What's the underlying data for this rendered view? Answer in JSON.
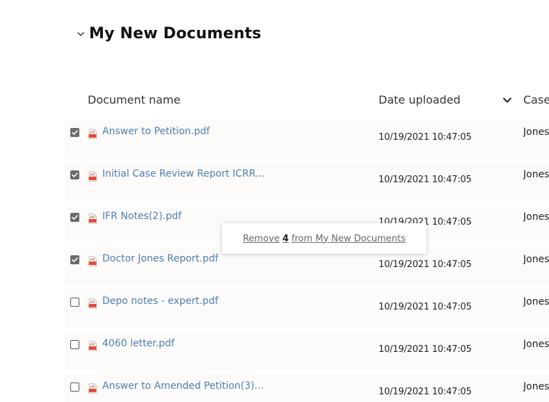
{
  "section": {
    "title": "My New Documents",
    "collapse_icon": "chevron-down-icon"
  },
  "table": {
    "columns": [
      "Document name",
      "Date uploaded",
      "Case"
    ],
    "sort_icon": "chevron-down-icon",
    "rows": [
      {
        "name": "Answer to Petition.pdf",
        "date": "10/19/2021 10:47:05",
        "case": "Jones",
        "checked": true
      },
      {
        "name": "Initial Case Review Report ICRR...",
        "date": "10/19/2021 10:47:05",
        "case": "Jones",
        "checked": true
      },
      {
        "name": "IFR Notes(2).pdf",
        "date": "10/19/2021 10:47:05",
        "case": "Jones",
        "checked": true
      },
      {
        "name": "Doctor Jones Report.pdf",
        "date": "10/19/2021 10:47:05",
        "case": "Jones",
        "checked": true
      },
      {
        "name": "Depo notes - expert.pdf",
        "date": "10/19/2021 10:47:05",
        "case": "Jones",
        "checked": false
      },
      {
        "name": "4060 letter.pdf",
        "date": "10/19/2021 10:47:05",
        "case": "Jones",
        "checked": false
      },
      {
        "name": "Answer to Amended Petition(3)...",
        "date": "10/19/2021 10:47:05",
        "case": "Jones",
        "checked": false
      }
    ],
    "file_icon": "pdf-file-icon"
  },
  "popup": {
    "prefix": "Remove",
    "count": "4",
    "suffix": "from My New Documents"
  },
  "colors": {
    "link": "#4a7fb5",
    "row_background": "#fdfbf9",
    "checkbox_checked": "#6b6b6b"
  }
}
